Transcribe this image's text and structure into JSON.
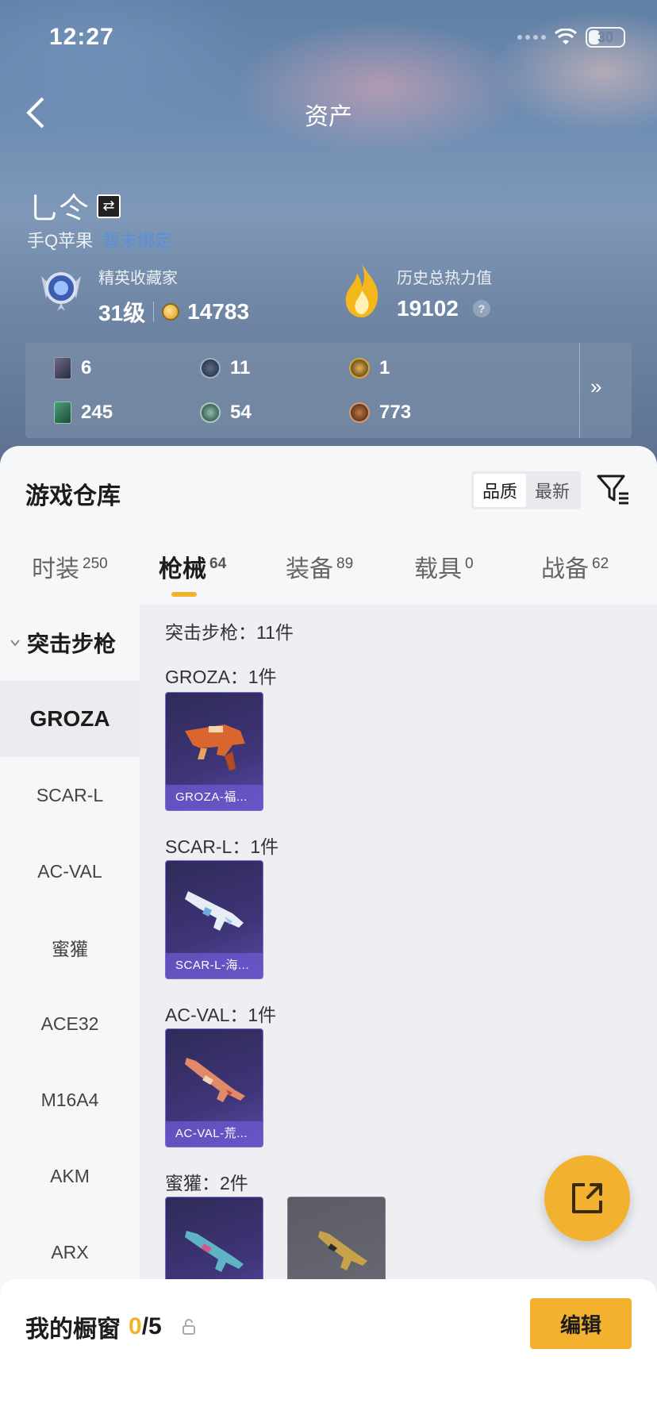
{
  "status": {
    "time": "12:27",
    "battery": "30"
  },
  "header": {
    "title": "资产"
  },
  "profile": {
    "username": "乚仒",
    "platform": "手Q苹果",
    "platform_link": "暂未绑定",
    "level_label": "精英收藏家",
    "level": "31级",
    "coins": "14783",
    "heat_label": "历史总热力值",
    "heat_value": "19102",
    "heat_help": "?"
  },
  "stats": [
    {
      "icon": "card-icon",
      "value": "6"
    },
    {
      "icon": "clock-medal-icon",
      "value": "11"
    },
    {
      "icon": "gold-a-medal-icon",
      "value": "1"
    },
    {
      "icon": "green-card-icon",
      "value": "245"
    },
    {
      "icon": "teal-orb-icon",
      "value": "54"
    },
    {
      "icon": "bronze-orb-icon",
      "value": "773"
    }
  ],
  "warehouse": {
    "title": "游戏仓库",
    "sort": [
      "品质",
      "最新"
    ],
    "tabs": [
      {
        "label": "时装",
        "count": "250"
      },
      {
        "label": "枪械",
        "count": "64"
      },
      {
        "label": "装备",
        "count": "89"
      },
      {
        "label": "载具",
        "count": "0"
      },
      {
        "label": "战备",
        "count": "62"
      }
    ]
  },
  "sidebar": {
    "category": "突击步枪",
    "items": [
      "GROZA",
      "SCAR-L",
      "AC-VAL",
      "蜜獾",
      "ACE32",
      "M16A4",
      "AKM",
      "ARX"
    ]
  },
  "content": {
    "category_summary": "突击步枪：11件",
    "groups": [
      {
        "title": "GROZA：1件",
        "items": [
          "GROZA-福..."
        ]
      },
      {
        "title": "SCAR-L：1件",
        "items": [
          "SCAR-L-海..."
        ]
      },
      {
        "title": "AC-VAL：1件",
        "items": [
          "AC-VAL-荒..."
        ]
      },
      {
        "title": "蜜獾：2件",
        "items": [
          "",
          ""
        ]
      }
    ]
  },
  "showcase": {
    "label": "我的橱窗",
    "count": "0",
    "total": "/5",
    "edit_label": "编辑"
  },
  "colors": {
    "accent": "#f2b12e",
    "card_bg": "#3e3578",
    "card_label": "#6e5ad2"
  }
}
